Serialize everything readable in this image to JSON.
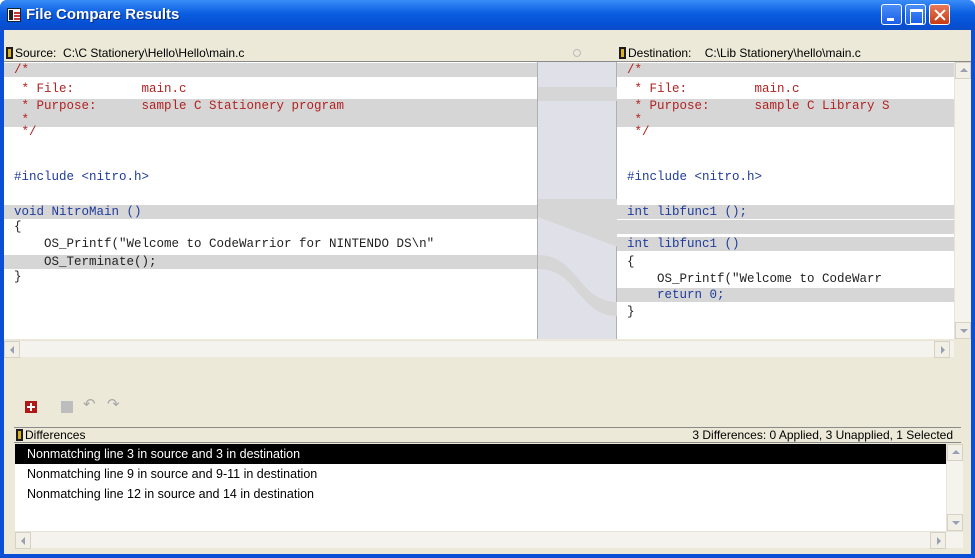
{
  "window": {
    "title": "File Compare Results"
  },
  "source": {
    "label": "Source:",
    "path": "C:\\C Stationery\\Hello\\Hello\\main.c",
    "lines": [
      {
        "text": "/*",
        "cls": "cm",
        "hl": true
      },
      {
        "text": " * File:         main.c",
        "cls": "cm",
        "hl": false
      },
      {
        "text": " * Purpose:      sample C Stationery program",
        "cls": "cm",
        "hl": true
      },
      {
        "text": " *",
        "cls": "cm",
        "hl": true
      },
      {
        "text": " */",
        "cls": "cm",
        "hl": false
      },
      {
        "text": "",
        "cls": "pl",
        "hl": false
      },
      {
        "text": "#include <nitro.h>",
        "cls": "kw",
        "hl": false
      },
      {
        "text": "",
        "cls": "pl",
        "hl": false
      },
      {
        "text": "void NitroMain ()",
        "cls": "kw",
        "hl": true
      },
      {
        "text": "{",
        "cls": "pl",
        "hl": false
      },
      {
        "text": "    OS_Printf(\"Welcome to CodeWarrior for NINTENDO DS\\n\"",
        "cls": "pl",
        "hl": false
      },
      {
        "text": "    OS_Terminate();",
        "cls": "pl",
        "hl": true
      },
      {
        "text": "}",
        "cls": "pl",
        "hl": false
      }
    ]
  },
  "destination": {
    "label": "Destination:",
    "path": "C:\\Lib Stationery\\hello\\main.c",
    "lines": [
      {
        "text": "/*",
        "cls": "cm",
        "hl": true
      },
      {
        "text": " * File:         main.c",
        "cls": "cm",
        "hl": false
      },
      {
        "text": " * Purpose:      sample C Library S",
        "cls": "cm",
        "hl": true
      },
      {
        "text": " *",
        "cls": "cm",
        "hl": true
      },
      {
        "text": " */",
        "cls": "cm",
        "hl": false
      },
      {
        "text": "",
        "cls": "pl",
        "hl": false
      },
      {
        "text": "#include <nitro.h>",
        "cls": "kw",
        "hl": false
      },
      {
        "text": "",
        "cls": "pl",
        "hl": false
      },
      {
        "text": "int libfunc1 ();",
        "cls": "kw",
        "hl": true
      },
      {
        "text": "",
        "cls": "pl",
        "hl": true
      },
      {
        "text": "int libfunc1 ()",
        "cls": "kw",
        "hl": true
      },
      {
        "text": "{",
        "cls": "pl",
        "hl": false
      },
      {
        "text": "    OS_Printf(\"Welcome to CodeWarr",
        "cls": "pl",
        "hl": false
      },
      {
        "text": "    return 0;",
        "cls": "kw",
        "hl": true
      },
      {
        "text": "}",
        "cls": "pl",
        "hl": false
      }
    ]
  },
  "toolbar": {
    "icons": [
      "add-icon",
      "stop-icon",
      "undo-icon",
      "redo-icon"
    ]
  },
  "differences": {
    "label": "Differences",
    "summary": "3 Differences:  0 Applied, 3 Unapplied, 1 Selected",
    "items": [
      {
        "text": "Nonmatching line 3 in source and 3 in destination",
        "selected": true
      },
      {
        "text": "Nonmatching line 9 in source and 9-11 in destination",
        "selected": false
      },
      {
        "text": "Nonmatching line 12 in source and 14 in destination",
        "selected": false
      }
    ]
  }
}
